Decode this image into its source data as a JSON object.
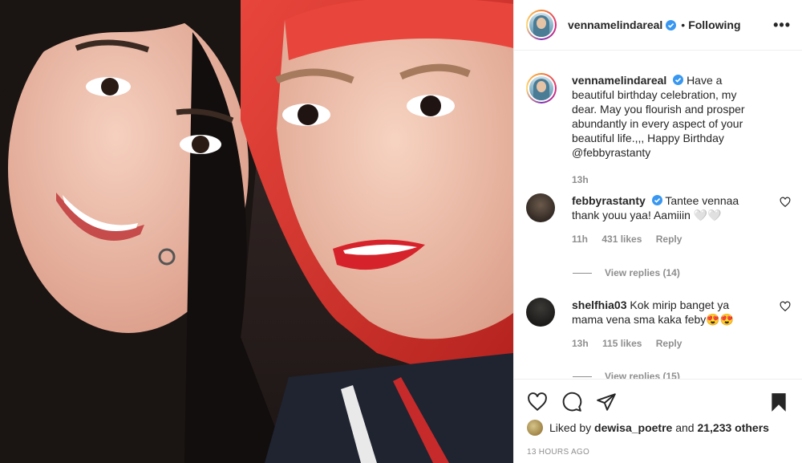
{
  "post": {
    "author": "vennamelindareal",
    "follow_separator": "•",
    "follow_status": "Following",
    "more_icon": "•••",
    "image_description_icon": "photo"
  },
  "caption": {
    "user": "vennamelindareal",
    "text": "Have a beautiful birthday celebration, my dear. May you flourish and prosper abundantly in every aspect of your beautiful life.,,, Happy Birthday @febbyrastanty",
    "time": "13h"
  },
  "comments": [
    {
      "user": "febbyrastanty",
      "text": "Tantee vennaa thank youu yaa! Aamiiin 🤍🤍",
      "time": "11h",
      "likes": "431 likes",
      "reply": "Reply",
      "view_replies": "View replies (14)"
    },
    {
      "user": "shelfhia03",
      "text": "Kok mirip banget ya mama vena sma kaka feby😍😍",
      "time": "13h",
      "likes": "115 likes",
      "reply": "Reply",
      "view_replies": "View replies (15)"
    }
  ],
  "actions": {
    "liked_prefix": "Liked by",
    "liked_user": "dewisa_poetre",
    "liked_and": "and",
    "liked_count": "21,233 others",
    "timestamp": "13 HOURS AGO"
  },
  "colors": {
    "verified": "#3897f0",
    "muted": "#8e8e8e",
    "text": "#262626"
  }
}
